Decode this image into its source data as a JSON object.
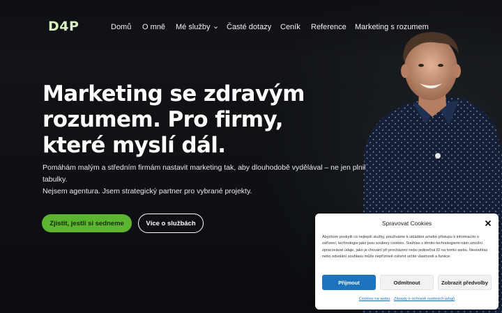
{
  "header": {
    "logo": "D4P",
    "nav": [
      {
        "label": "Domů"
      },
      {
        "label": "O mně"
      },
      {
        "label": "Mé služby",
        "has_dropdown": true
      },
      {
        "label": "Časté dotazy"
      },
      {
        "label": "Ceník"
      },
      {
        "label": "Reference"
      },
      {
        "label": "Marketing s rozumem"
      }
    ]
  },
  "hero": {
    "title_line1": "Marketing se zdravým",
    "title_line2": "rozumem. Pro firmy,",
    "title_line3": "které myslí dál.",
    "text_line1": "Pomáhám malým a středním firmám nastavit marketing tak, aby dlouhodobě vydělával – ne jen plnil tabulky.",
    "text_line2": "Nejsem agentura. Jsem strategický partner pro vybrané projekty.",
    "primary_button": "Zjistit, jestli si sedneme",
    "secondary_button": "Více o službách"
  },
  "cookie": {
    "title": "Spravovat Cookies",
    "text": "Abychom poskytli co nejlepší služby, používáme k ukládání a/nebo přístupu k informacím o zařízení, technologie jako jsou soubory cookies. Souhlas s těmito technologiemi nám umožní zpracovávat údaje, jako je chování při procházení nebo jedinečná ID na tomto webu. Nesouhlas nebo odvolání souhlasu může nepříznivě ovlivnit určité vlastnosti a funkce.",
    "accept_button": "Přijmout",
    "deny_button": "Odmítnout",
    "prefs_button": "Zobrazit předvolby",
    "link_policy": "Cookies na webu",
    "link_privacy": "Zásady o ochraně osobních údajů"
  },
  "colors": {
    "background": "#0d0f12",
    "accent_green": "#5cb531",
    "logo": "#d9f0c2",
    "accept_blue": "#1e73be"
  }
}
